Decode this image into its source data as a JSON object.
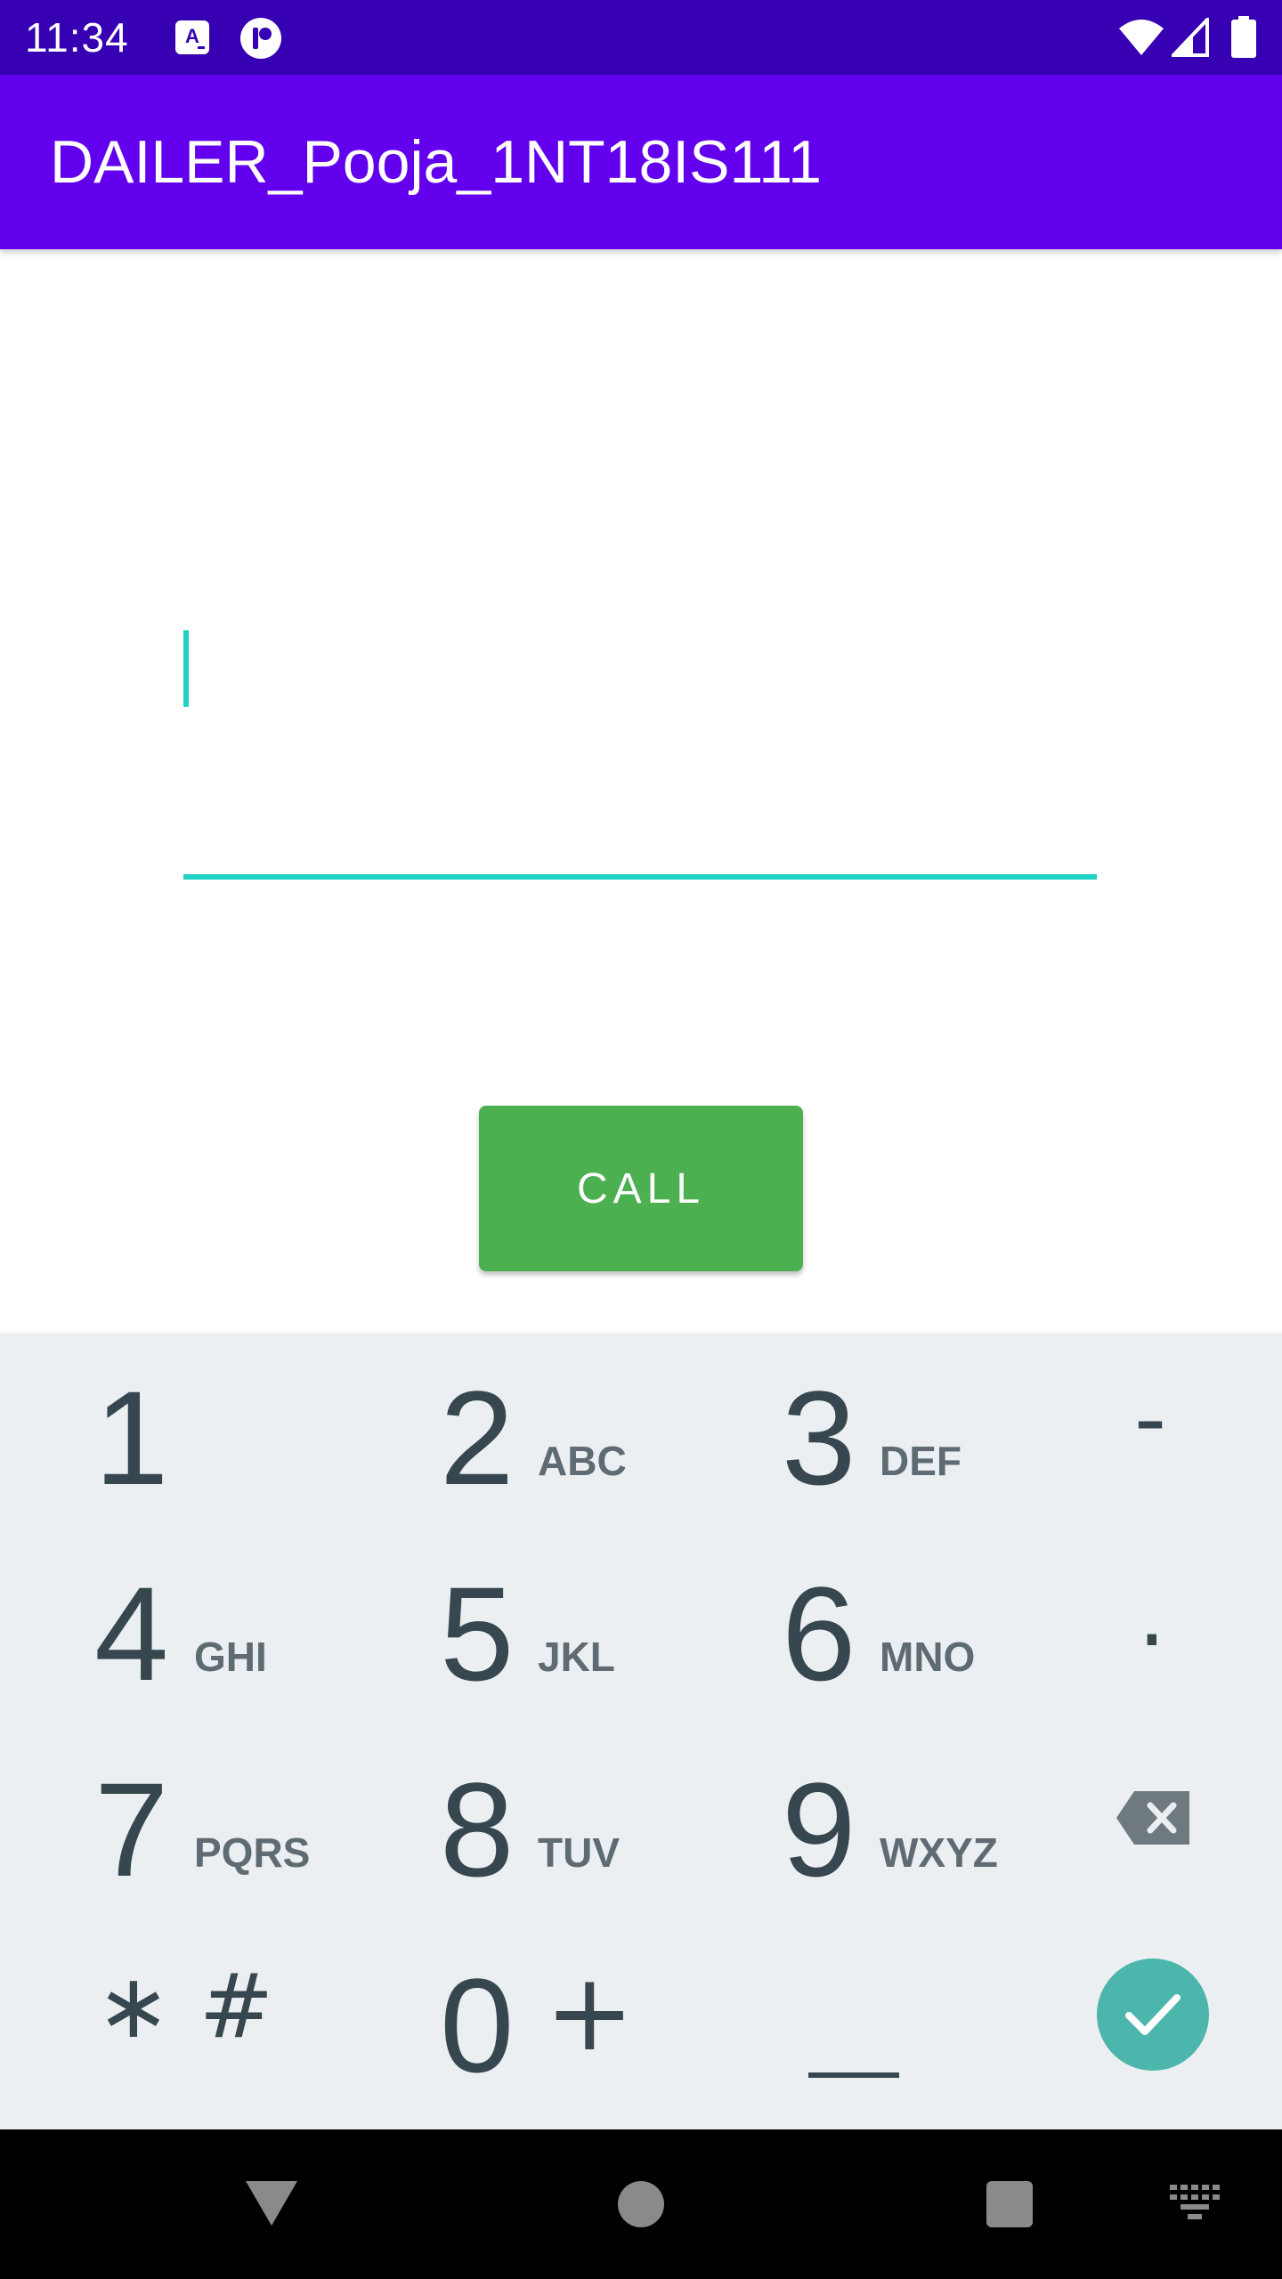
{
  "status_bar": {
    "time": "11:34",
    "icons": [
      "translate-notification-icon",
      "app-notification-icon",
      "wifi-icon",
      "cellular-signal-icon",
      "battery-icon"
    ],
    "background": "#3700b3"
  },
  "app_bar": {
    "title": "DAILER_Pooja_1NT18IS111",
    "background": "#6200ee"
  },
  "number_field": {
    "value": "",
    "placeholder": "",
    "accent": "#1ed3c3"
  },
  "call_button": {
    "label": "CALL",
    "background": "#4caf50"
  },
  "keypad": {
    "background": "#eceff1",
    "keys": [
      {
        "digit": "1",
        "letters": ""
      },
      {
        "digit": "2",
        "letters": "ABC"
      },
      {
        "digit": "3",
        "letters": "DEF"
      },
      {
        "digit": "4",
        "letters": "GHI"
      },
      {
        "digit": "5",
        "letters": "JKL"
      },
      {
        "digit": "6",
        "letters": "MNO"
      },
      {
        "digit": "7",
        "letters": "PQRS"
      },
      {
        "digit": "8",
        "letters": "TUV"
      },
      {
        "digit": "9",
        "letters": "WXYZ"
      },
      {
        "digit": "0",
        "letters": ""
      }
    ],
    "symbols": {
      "dash": "-",
      "dot": ".",
      "star_hash": "∗ #",
      "plus": "+"
    },
    "action_icons": [
      "backspace-icon",
      "done-check-icon",
      "space-key"
    ],
    "done_color": "#4db6ac"
  },
  "nav_bar": {
    "icons": [
      "back-icon",
      "home-icon",
      "recents-icon",
      "keyboard-icon"
    ]
  }
}
